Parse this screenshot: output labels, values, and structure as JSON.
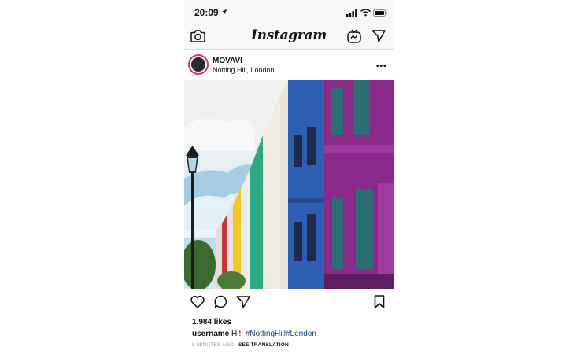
{
  "status_bar": {
    "time": "20:09"
  },
  "top_bar": {
    "title": "Instagram"
  },
  "post": {
    "username": "MOVAVI",
    "location": "Notting Hill, London",
    "likes": "1.984 likes",
    "caption_user": "username",
    "caption_text": "Hi!!",
    "hashtag_1": "#NottingHill",
    "hashtag_2": "#London",
    "time_ago": "9 MINUTES AGO",
    "see_translation": "SEE TRANSLATION"
  },
  "icons": {
    "camera": "camera-icon",
    "igtv": "igtv-icon",
    "direct": "paper-plane-icon",
    "more": "more-icon",
    "like": "heart-icon",
    "comment": "comment-icon",
    "share": "paper-plane-icon",
    "save": "bookmark-icon"
  },
  "colors": {
    "avatar_ring": "#e1306c",
    "hashtag": "#1d3f7a"
  }
}
